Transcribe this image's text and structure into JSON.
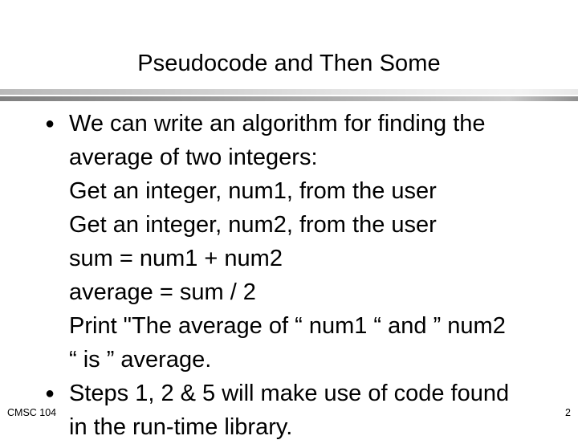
{
  "slide": {
    "title": "Pseudocode and Then Some",
    "page_number": "2",
    "footer_label": "CMSC 104",
    "background_color": "#ffffff",
    "text_color": "#000000",
    "divider": {
      "top_bar_colors": [
        "#b9b9b9",
        "#f3f3f3"
      ],
      "bottom_bar_colors": [
        "#808080",
        "#cacaca"
      ]
    },
    "bullet_glyph": "●",
    "body_lines": [
      {
        "bullet": true,
        "text": "We can write an algorithm for finding the"
      },
      {
        "bullet": false,
        "text": "average of two integers:"
      },
      {
        "bullet": false,
        "text": "Get an integer, num1, from the user"
      },
      {
        "bullet": false,
        "text": "Get an integer, num2, from the user"
      },
      {
        "bullet": false,
        "text": "sum = num1 + num2"
      },
      {
        "bullet": false,
        "text": "average = sum / 2"
      },
      {
        "bullet": false,
        "text": "Print \"The average of  “ num1 “ and ” num2"
      },
      {
        "bullet": false,
        "text": "“ is ” average."
      },
      {
        "bullet": true,
        "text": "Steps 1, 2 & 5 will make use of code found"
      },
      {
        "bullet": false,
        "text": "in the run-time library."
      }
    ]
  }
}
